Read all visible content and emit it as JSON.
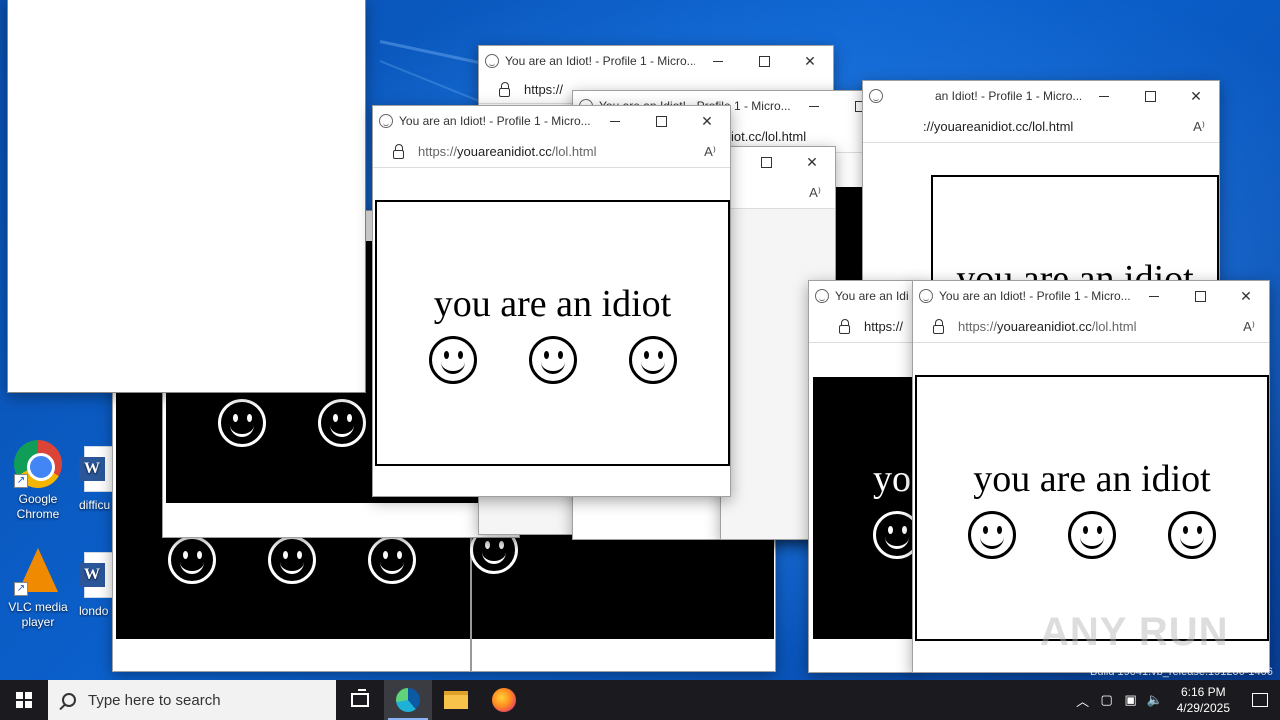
{
  "desktop": {
    "icons": [
      {
        "label": "Google Chrome",
        "icon": "chrome-icon"
      },
      {
        "label": "VLC media player",
        "icon": "vlc-icon"
      },
      {
        "label": "difficu",
        "icon": "word-doc-icon"
      },
      {
        "label": "londo",
        "icon": "word-doc-icon"
      }
    ],
    "watermark": "ANY RUN",
    "build_text": "Build 19041.vb_release.191206-1406"
  },
  "windows": {
    "title": "You are an Idiot! - Profile 1 - Micro...",
    "title_cut_a": "You are an Idi",
    "title_cut_b": "an Idiot! - Profile 1 - Micro...",
    "url_prefix": "https://",
    "url_host": "youareanidiot.cc",
    "url_path": "/lol.html",
    "url_cut_a": "iot.cc/lol.html",
    "url_cut_b": "https://",
    "url_cut_c": "://youareanidiot.cc/lol.html",
    "message": "you are an idiot",
    "message_cut": "yo",
    "read_aloud_icon": "A⁾"
  },
  "taskbar": {
    "search_placeholder": "Type here to search",
    "apps": [
      "task-view",
      "edge",
      "file-explorer",
      "firefox"
    ],
    "time": "6:16 PM",
    "date": "4/29/2025"
  }
}
